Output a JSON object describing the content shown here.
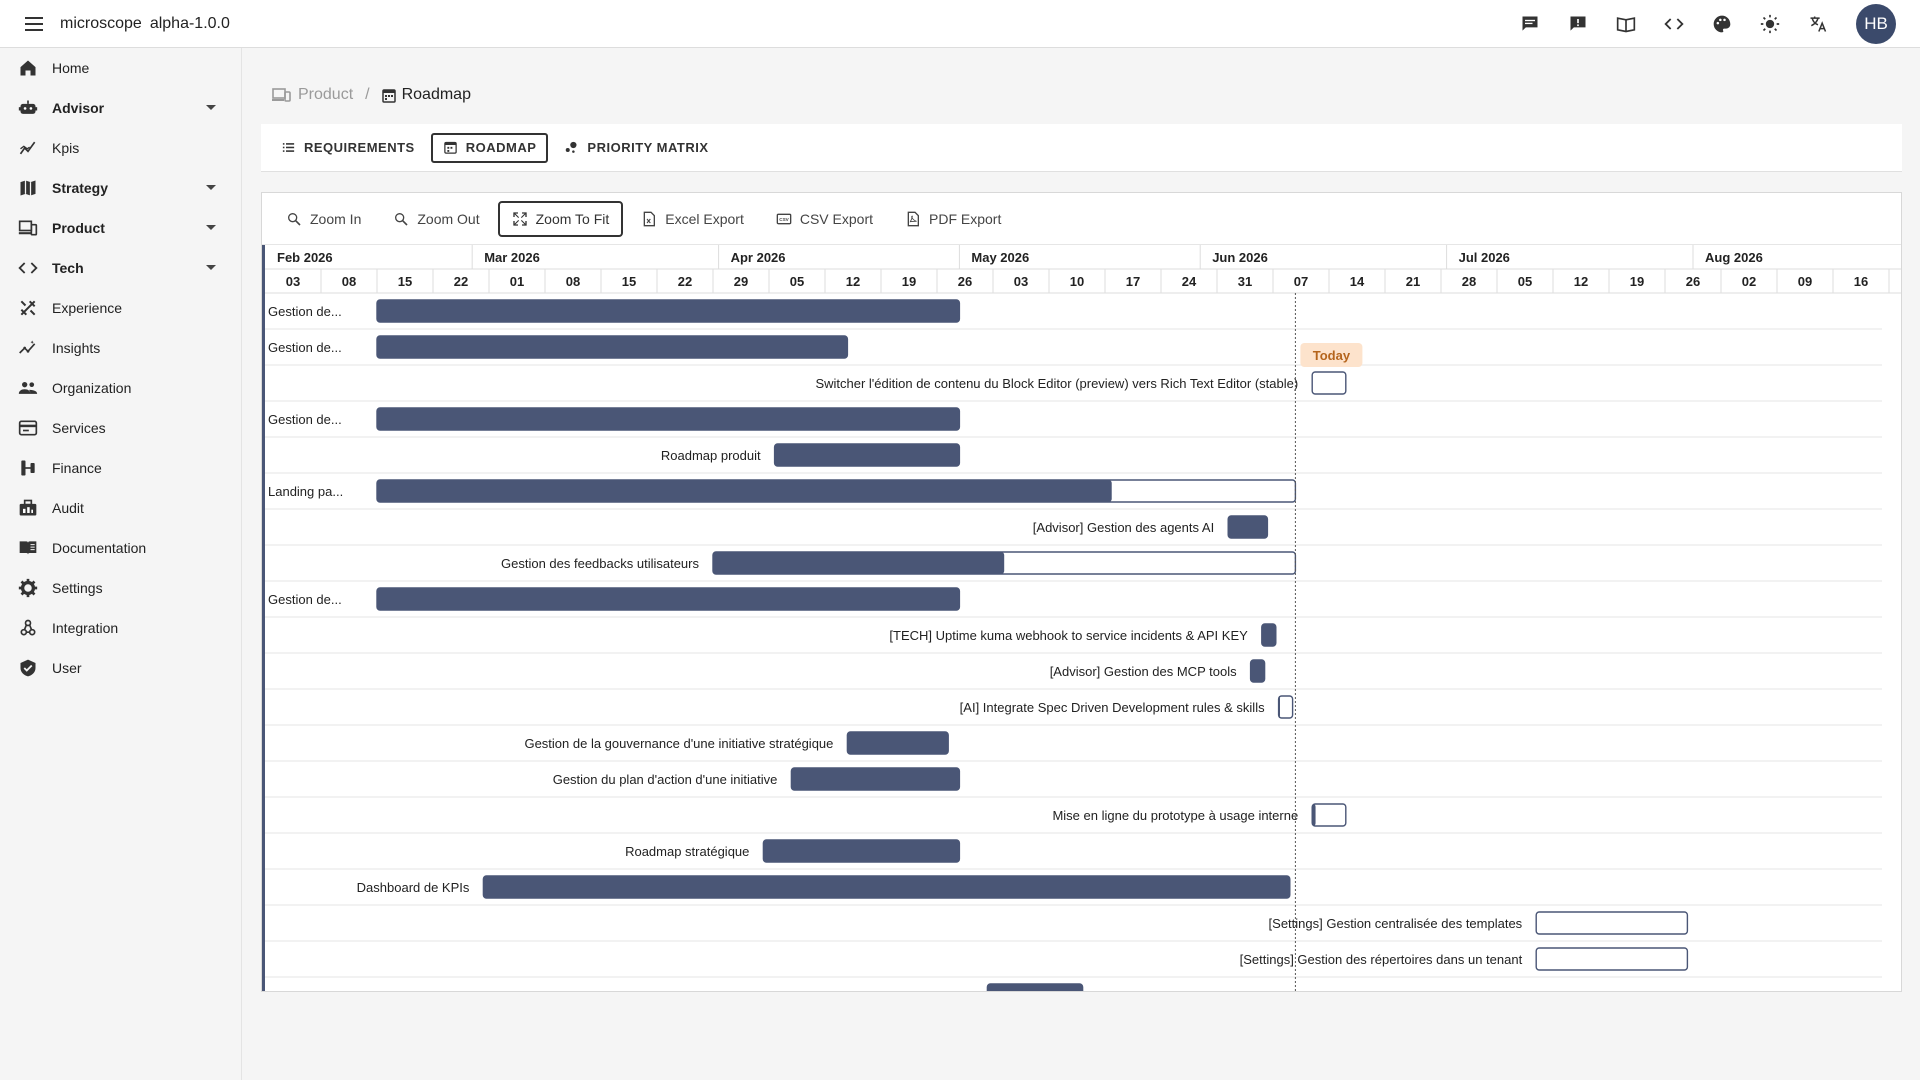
{
  "app": {
    "name": "microscope",
    "version": "alpha-1.0.0",
    "user_initials": "HB"
  },
  "topbar_icons": [
    "chat-icon",
    "feedback-icon",
    "docs-icon",
    "code-icon",
    "palette-icon",
    "brightness-icon",
    "translate-icon"
  ],
  "sidebar": {
    "items": [
      {
        "label": "Home",
        "icon": "home-icon",
        "bold": false,
        "expandable": false
      },
      {
        "label": "Advisor",
        "icon": "robot-icon",
        "bold": true,
        "expandable": true
      },
      {
        "label": "Kpis",
        "icon": "analytics-icon",
        "bold": false,
        "expandable": false
      },
      {
        "label": "Strategy",
        "icon": "map-icon",
        "bold": true,
        "expandable": true
      },
      {
        "label": "Product",
        "icon": "devices-icon",
        "bold": true,
        "expandable": true
      },
      {
        "label": "Tech",
        "icon": "code-icon",
        "bold": true,
        "expandable": true
      },
      {
        "label": "Experience",
        "icon": "design-icon",
        "bold": false,
        "expandable": false
      },
      {
        "label": "Insights",
        "icon": "insights-icon",
        "bold": false,
        "expandable": false
      },
      {
        "label": "Organization",
        "icon": "people-icon",
        "bold": false,
        "expandable": false
      },
      {
        "label": "Services",
        "icon": "services-icon",
        "bold": false,
        "expandable": false
      },
      {
        "label": "Finance",
        "icon": "finance-icon",
        "bold": false,
        "expandable": false
      },
      {
        "label": "Audit",
        "icon": "audit-icon",
        "bold": false,
        "expandable": false
      },
      {
        "label": "Documentation",
        "icon": "book-icon",
        "bold": false,
        "expandable": false
      },
      {
        "label": "Settings",
        "icon": "gear-icon",
        "bold": false,
        "expandable": false
      },
      {
        "label": "Integration",
        "icon": "integration-icon",
        "bold": false,
        "expandable": false
      },
      {
        "label": "User",
        "icon": "shield-icon",
        "bold": false,
        "expandable": false
      }
    ]
  },
  "breadcrumb": {
    "parent": "Product",
    "current": "Roadmap"
  },
  "tabs": [
    {
      "label": "REQUIREMENTS",
      "icon": "list-icon",
      "active": false
    },
    {
      "label": "ROADMAP",
      "icon": "calendar-icon",
      "active": true
    },
    {
      "label": "PRIORITY MATRIX",
      "icon": "bubble-icon",
      "active": false
    }
  ],
  "toolbar": [
    {
      "label": "Zoom In",
      "icon": "zoom-in-icon",
      "active": false
    },
    {
      "label": "Zoom Out",
      "icon": "zoom-out-icon",
      "active": false
    },
    {
      "label": "Zoom To Fit",
      "icon": "fit-icon",
      "active": true
    },
    {
      "label": "Excel Export",
      "icon": "excel-icon",
      "active": false
    },
    {
      "label": "CSV Export",
      "icon": "csv-icon",
      "active": false
    },
    {
      "label": "PDF Export",
      "icon": "pdf-icon",
      "active": false
    }
  ],
  "timeline": {
    "months": [
      "Feb 2026",
      "Mar 2026",
      "Apr 2026",
      "May 2026",
      "Jun 2026",
      "Jul 2026",
      "Aug 2026"
    ],
    "weeks": [
      "03",
      "08",
      "15",
      "22",
      "01",
      "08",
      "15",
      "22",
      "29",
      "05",
      "12",
      "19",
      "26",
      "03",
      "10",
      "17",
      "24",
      "31",
      "07",
      "14",
      "21",
      "28",
      "05",
      "12",
      "19",
      "26",
      "02",
      "09",
      "16",
      "2"
    ],
    "today_label": "Today",
    "today_week_index": 18.4
  },
  "colors": {
    "bar": "#4a5676",
    "bar_border": "#4a5676",
    "today_badge": "#fde3cc",
    "today_text": "#b5651d"
  },
  "tasks": [
    {
      "label": "Gestion de...",
      "start": 2,
      "end": 12.4,
      "progress": 1.0
    },
    {
      "label": "Gestion de...",
      "start": 2,
      "end": 10.4,
      "progress": 1.0
    },
    {
      "label": "Switcher l'édition de contenu du Block Editor (preview) vers Rich Text Editor (stable)",
      "start": 18.7,
      "end": 19.3,
      "progress": 0
    },
    {
      "label": "Gestion de...",
      "start": 2,
      "end": 12.4,
      "progress": 1.0
    },
    {
      "label": "Roadmap produit",
      "start": 9.1,
      "end": 12.4,
      "progress": 1.0
    },
    {
      "label": "Landing pa...",
      "start": 2,
      "end": 18.4,
      "progress": 0.8
    },
    {
      "label": "[Advisor] Gestion des agents AI",
      "start": 17.2,
      "end": 17.9,
      "progress": 1.0
    },
    {
      "label": "Gestion des feedbacks utilisateurs",
      "start": 8,
      "end": 18.4,
      "progress": 0.5
    },
    {
      "label": "Gestion de...",
      "start": 2,
      "end": 12.4,
      "progress": 1.0
    },
    {
      "label": "[TECH] Uptime kuma webhook to service incidents & API KEY",
      "start": 17.8,
      "end": 18.05,
      "progress": 1.0
    },
    {
      "label": "[Advisor] Gestion des MCP tools",
      "start": 17.6,
      "end": 17.85,
      "progress": 1.0
    },
    {
      "label": "[AI] Integrate Spec Driven Development rules & skills",
      "start": 18.1,
      "end": 18.35,
      "progress": 0.1
    },
    {
      "label": "Gestion de la gouvernance d'une initiative stratégique",
      "start": 10.4,
      "end": 12.2,
      "progress": 1.0
    },
    {
      "label": "Gestion du plan d'action d'une initiative",
      "start": 9.4,
      "end": 12.4,
      "progress": 1.0
    },
    {
      "label": "Mise en ligne du prototype à usage interne",
      "start": 18.7,
      "end": 19.3,
      "progress": 0.1
    },
    {
      "label": "Roadmap stratégique",
      "start": 8.9,
      "end": 12.4,
      "progress": 1.0
    },
    {
      "label": "Dashboard de KPIs",
      "start": 3.9,
      "end": 18.3,
      "progress": 1.0
    },
    {
      "label": "[Settings] Gestion centralisée des templates",
      "start": 22.7,
      "end": 25.4,
      "progress": 0
    },
    {
      "label": "[Settings] Gestion des répertoires dans un tenant",
      "start": 22.7,
      "end": 25.4,
      "progress": 0
    },
    {
      "label": "",
      "start": 12.9,
      "end": 14.6,
      "progress": 1.0
    }
  ]
}
